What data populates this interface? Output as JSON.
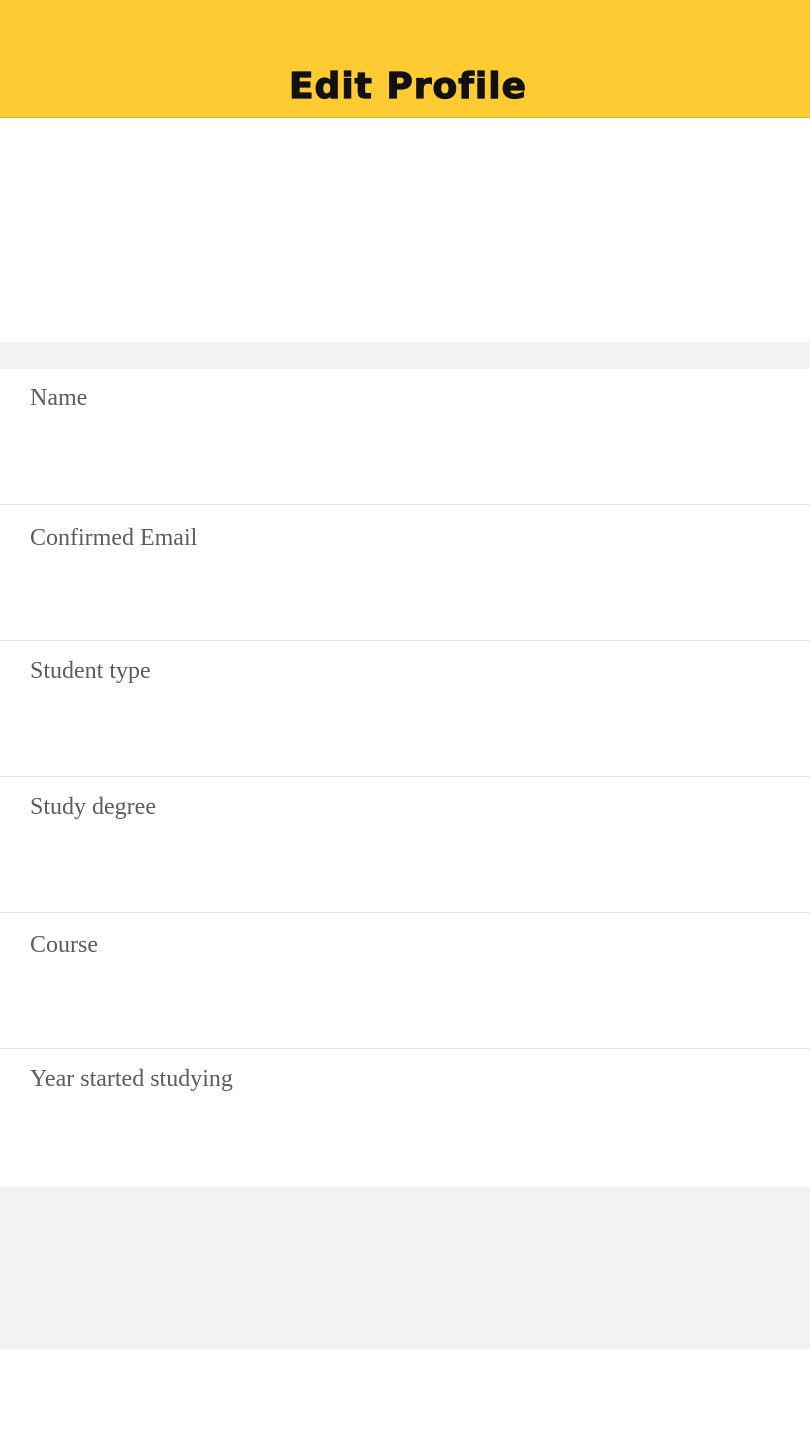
{
  "colors": {
    "header_bg": "#FFCB33",
    "page_gap": "#F2F2F2",
    "label": "#5C5C5C"
  },
  "header": {
    "title": "Edit Profile"
  },
  "form": {
    "fields": [
      {
        "label": "Name",
        "value": ""
      },
      {
        "label": "Confirmed Email",
        "value": ""
      },
      {
        "label": "Student type",
        "value": ""
      },
      {
        "label": "Study degree",
        "value": ""
      },
      {
        "label": "Course",
        "value": ""
      },
      {
        "label": "Year started studying",
        "value": ""
      }
    ]
  }
}
